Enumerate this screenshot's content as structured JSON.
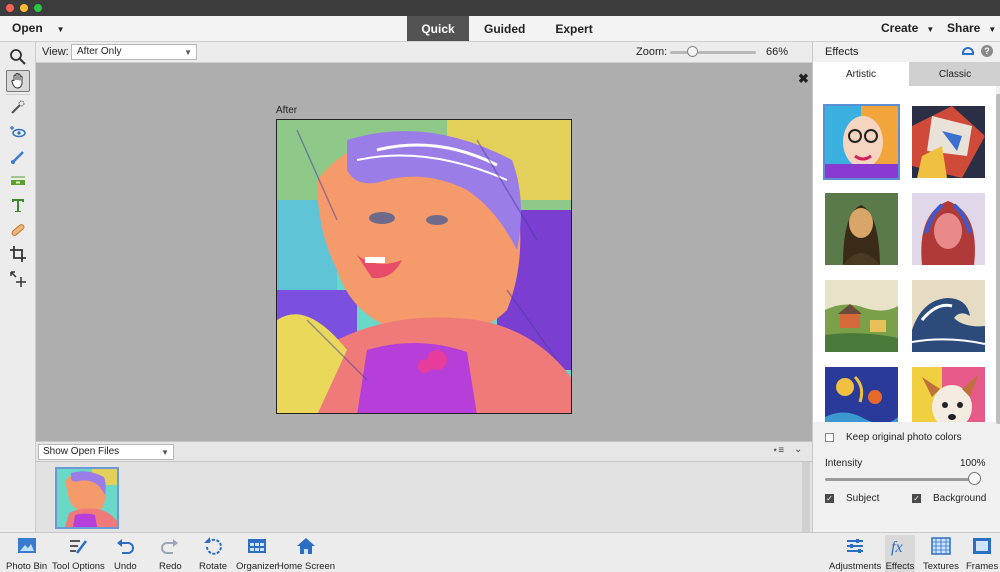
{
  "menubar": {
    "open": "Open",
    "modes": [
      "Quick",
      "Guided",
      "Expert"
    ],
    "active_mode": "Quick",
    "create": "Create",
    "share": "Share"
  },
  "toolbox": {
    "tools": [
      "zoom-tool",
      "hand-tool",
      "quick-selection-tool",
      "red-eye-tool",
      "whiten-teeth-tool",
      "straighten-tool",
      "type-tool",
      "spot-healing-tool",
      "crop-tool",
      "move-tool"
    ],
    "selected": "hand-tool"
  },
  "options": {
    "view_label": "View:",
    "view_value": "After Only",
    "zoom_label": "Zoom:",
    "zoom_value": "66%",
    "zoom_fraction": 0.22
  },
  "canvas": {
    "after_label": "After"
  },
  "photo_bin": {
    "select_value": "Show Open Files"
  },
  "effects": {
    "title": "Effects",
    "tabs": [
      "Artistic",
      "Classic"
    ],
    "active_tab": "Artistic",
    "keep_colors": "Keep original photo colors",
    "keep_colors_checked": false,
    "intensity_label": "Intensity",
    "intensity_value": "100%",
    "intensity_fraction": 1.0,
    "subject": "Subject",
    "subject_checked": true,
    "background": "Background",
    "background_checked": true
  },
  "taskbar": {
    "left": [
      "Photo Bin",
      "Tool Options",
      "Undo",
      "Redo",
      "Rotate",
      "Organizer",
      "Home Screen"
    ],
    "right": [
      "Adjustments",
      "Effects",
      "Textures",
      "Frames"
    ]
  },
  "colors": {
    "accent": "#5a8fd6",
    "mode_active_bg": "#535353"
  }
}
